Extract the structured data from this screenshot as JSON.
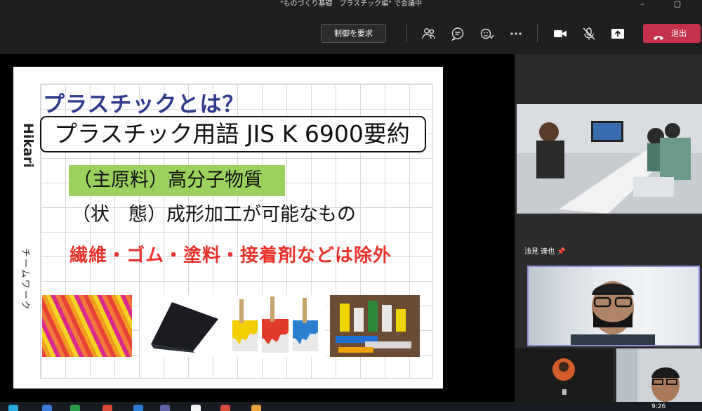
{
  "window": {
    "title": "\"ものづくり基礎　プラスチック編\" で会議中"
  },
  "toolbar": {
    "request_control_label": "制御を要求",
    "leave_label": "退出",
    "icons": [
      "people-icon",
      "chat-icon",
      "reactions-icon",
      "more-icon",
      "camera-icon",
      "mic-off-icon",
      "share-icon"
    ]
  },
  "slide": {
    "title": "プラスチックとは？",
    "term_box": "プラスチック用語 JIS K 6900要約",
    "brand": "Hikari",
    "vertical_text": "チームワーク",
    "line1": "（主原料）高分子物質",
    "line2": "（状　態）成形加工が可能なもの",
    "line3": "繊維・ゴム・塗料・接着剤などは除外"
  },
  "participants": {
    "pinned_name": "浅見 達也"
  },
  "taskbar": {
    "clock": "9:26"
  },
  "colors": {
    "leave": "#c4314b",
    "title_blue": "#2f3a8f",
    "highlight_green": "#9bd25e",
    "emphasis_red": "#e8322a",
    "speaker_border": "#8c8dd6"
  }
}
